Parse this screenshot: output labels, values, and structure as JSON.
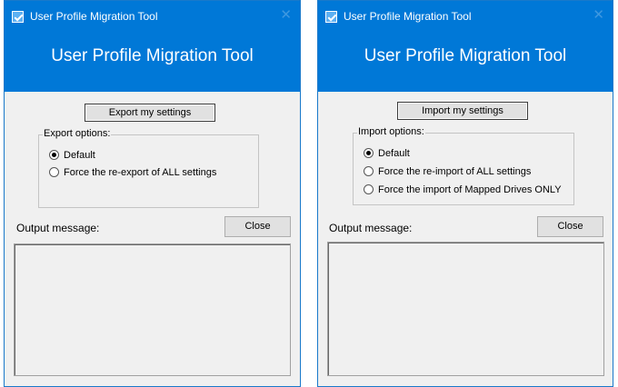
{
  "export_window": {
    "title": "User Profile Migration Tool",
    "banner": "User Profile Migration Tool",
    "action_button": "Export my settings",
    "options_legend": "Export options:",
    "options": [
      {
        "label": "Default",
        "selected": true
      },
      {
        "label": "Force the re-export of ALL settings",
        "selected": false
      }
    ],
    "output_label": "Output message:",
    "close_button": "Close",
    "output_text": ""
  },
  "import_window": {
    "title": "User Profile Migration Tool",
    "banner": "User Profile Migration Tool",
    "action_button": "Import my settings",
    "options_legend": "Import options:",
    "options": [
      {
        "label": "Default",
        "selected": true
      },
      {
        "label": "Force the re-import of ALL settings",
        "selected": false
      },
      {
        "label": "Force the import of Mapped Drives ONLY",
        "selected": false
      }
    ],
    "output_label": "Output message:",
    "close_button": "Close",
    "output_text": ""
  },
  "colors": {
    "titlebar": "#0078d7",
    "window_bg": "#f0f0f0",
    "button_bg": "#e1e1e1"
  }
}
